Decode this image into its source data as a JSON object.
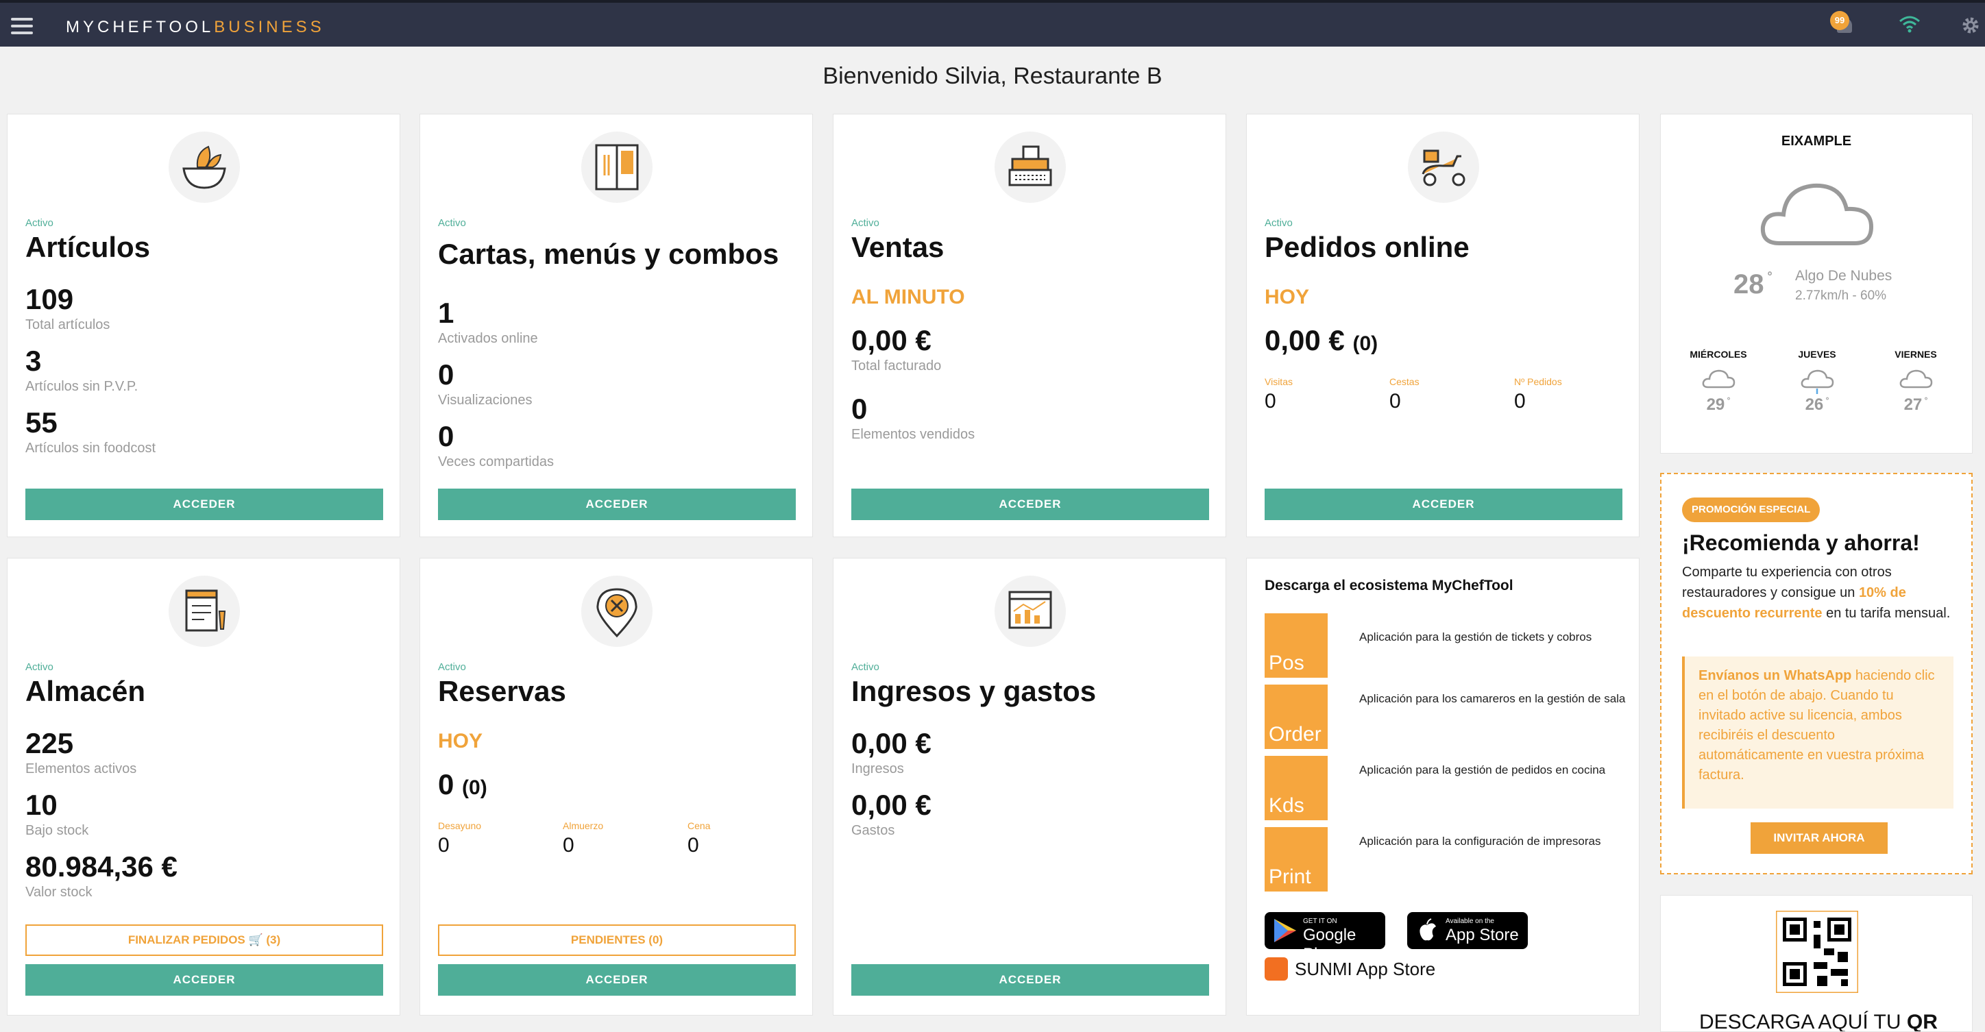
{
  "topbar": {
    "logo_main": "MYCHEFTOOL",
    "logo_accent": "BUSINESS",
    "notifications": "99"
  },
  "welcome": "Bienvenido Silvia, Restaurante B",
  "colors": {
    "accent": "#4fae98",
    "orange": "#f0a33a",
    "header": "#2f3447"
  },
  "cards": {
    "articulos": {
      "status": "Activo",
      "title": "Artículos",
      "stats": [
        {
          "value": "109",
          "label": "Total artículos"
        },
        {
          "value": "3",
          "label": "Artículos sin P.V.P."
        },
        {
          "value": "55",
          "label": "Artículos sin foodcost"
        }
      ],
      "button": "ACCEDER"
    },
    "cartas": {
      "status": "Activo",
      "title": "Cartas, menús y combos",
      "stats": [
        {
          "value": "1",
          "label": "Activados online"
        },
        {
          "value": "0",
          "label": "Visualizaciones"
        },
        {
          "value": "0",
          "label": "Veces compartidas"
        }
      ],
      "button": "ACCEDER"
    },
    "ventas": {
      "status": "Activo",
      "title": "Ventas",
      "period": "AL MINUTO",
      "stats": [
        {
          "value": "0,00 €",
          "label": "Total facturado"
        },
        {
          "value": "0",
          "label": "Elementos vendidos"
        }
      ],
      "button": "ACCEDER"
    },
    "pedidos": {
      "status": "Activo",
      "title": "Pedidos online",
      "period": "HOY",
      "amount": "0,00 €",
      "count": "(0)",
      "mini": [
        {
          "label": "Visitas",
          "value": "0"
        },
        {
          "label": "Cestas",
          "value": "0"
        },
        {
          "label": "Nº Pedidos",
          "value": "0"
        }
      ],
      "button": "ACCEDER"
    },
    "almacen": {
      "status": "Activo",
      "title": "Almacén",
      "stats": [
        {
          "value": "225",
          "label": "Elementos activos"
        },
        {
          "value": "10",
          "label": "Bajo stock"
        },
        {
          "value": "80.984,36 €",
          "label": "Valor stock"
        }
      ],
      "secondary": "FINALIZAR PEDIDOS 🛒 (3)",
      "button": "ACCEDER"
    },
    "reservas": {
      "status": "Activo",
      "title": "Reservas",
      "period": "HOY",
      "amount": "0",
      "count": "(0)",
      "mini": [
        {
          "label": "Desayuno",
          "value": "0"
        },
        {
          "label": "Almuerzo",
          "value": "0"
        },
        {
          "label": "Cena",
          "value": "0"
        }
      ],
      "secondary": "PENDIENTES (0)",
      "button": "ACCEDER"
    },
    "ingresos": {
      "status": "Activo",
      "title": "Ingresos y gastos",
      "stats": [
        {
          "value": "0,00 €",
          "label": "Ingresos"
        },
        {
          "value": "0,00 €",
          "label": "Gastos"
        }
      ],
      "button": "ACCEDER"
    }
  },
  "ecosystem": {
    "title": "Descarga el ecosistema MyChefTool",
    "apps": [
      {
        "name": "Pos",
        "desc": "Aplicación para la gestión de tickets y cobros"
      },
      {
        "name": "Order",
        "desc": "Aplicación para los camareros en la gestión de sala"
      },
      {
        "name": "Kds",
        "desc": "Aplicación para la gestión de pedidos en cocina"
      },
      {
        "name": "Print",
        "desc": "Aplicación para la configuración de impresoras"
      }
    ],
    "google_small": "GET IT ON",
    "google_big": "Google Play",
    "apple_small": "Available on the",
    "apple_big": "App Store",
    "sunmi": "SUNMI App Store"
  },
  "weather": {
    "location": "EIXAMPLE",
    "temp": "28",
    "desc": "Algo De Nubes",
    "wind": "2.77km/h - 60%",
    "days": [
      {
        "name": "MIÉRCOLES",
        "temp": "29"
      },
      {
        "name": "JUEVES",
        "temp": "26"
      },
      {
        "name": "VIERNES",
        "temp": "27"
      }
    ]
  },
  "promo": {
    "badge": "PROMOCIÓN ESPECIAL",
    "title": "¡Recomienda y ahorra!",
    "text_a": "Comparte tu experiencia con otros restauradores y consigue un ",
    "text_hl": "10% de descuento recurrente",
    "text_b": " en tu tarifa mensual.",
    "box_hl": "Envíanos un WhatsApp",
    "box_text": " haciendo clic en el botón de abajo. Cuando tu invitado active su licencia, ambos recibiréis el descuento automáticamente en vuestra próxima factura.",
    "button": "INVITAR AHORA"
  },
  "qr": {
    "label": "DESCARGA AQUÍ TU ",
    "label_bold": "QR"
  }
}
